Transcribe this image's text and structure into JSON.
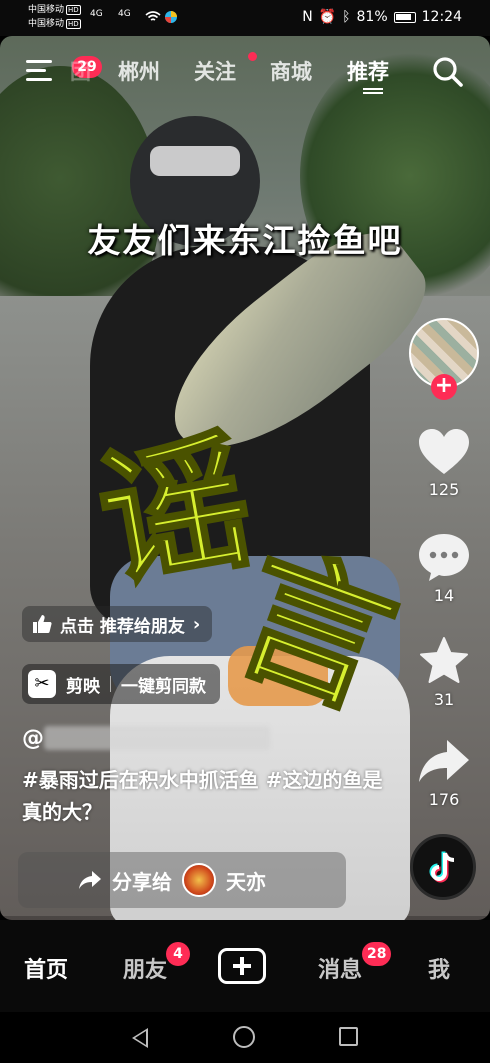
{
  "status_bar": {
    "carrier_1": "中国移动",
    "carrier_2": "中国移动",
    "hd": "HD",
    "signal_1": "4G",
    "signal_2": "4G",
    "battery": "81%",
    "time": "12:24"
  },
  "top_nav": {
    "menu_badge": "29",
    "tabs": [
      {
        "label": "郴州"
      },
      {
        "label": "关注"
      },
      {
        "label": "商城"
      },
      {
        "label": "推荐"
      }
    ]
  },
  "video": {
    "caption": "友友们来东江捡鱼吧",
    "stamp_1": "谣",
    "stamp_2": "言"
  },
  "actions": {
    "like_count": "125",
    "comment_count": "14",
    "favorite_count": "31",
    "share_count": "176"
  },
  "info": {
    "recommend_label": "点击 推荐给朋友",
    "capcut_name": "剪映",
    "capcut_action": "一键剪同款",
    "author": "@",
    "description": "#暴雨过后在积水中抓活鱼 #这边的鱼是真的大？",
    "share_label": "分享给",
    "share_friend": "天亦"
  },
  "tab_bar": {
    "home": "首页",
    "friends": "朋友",
    "friends_badge": "4",
    "messages": "消息",
    "messages_badge": "28",
    "me": "我"
  },
  "colors": {
    "accent": "#fe2c55",
    "stamp": "#d7ef2f"
  }
}
